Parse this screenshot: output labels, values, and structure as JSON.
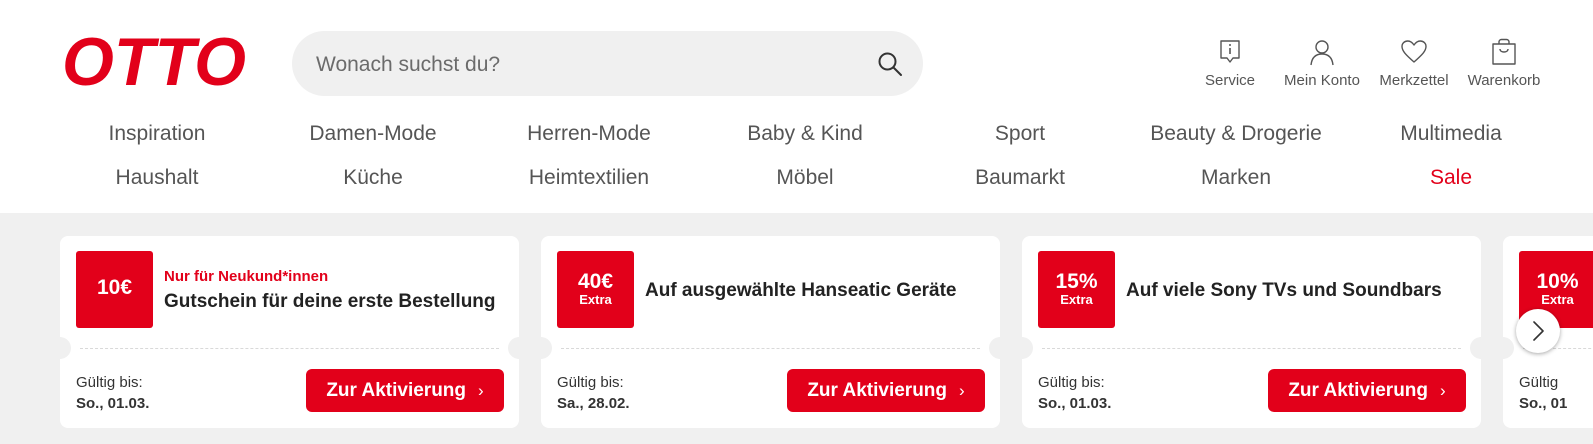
{
  "brand": {
    "logo_text": "OTTO",
    "accent": "#e2001a"
  },
  "search": {
    "placeholder": "Wonach suchst du?",
    "value": "",
    "icon": "search-icon"
  },
  "utility_nav": [
    {
      "label": "Service",
      "icon": "info-icon"
    },
    {
      "label": "Mein Konto",
      "icon": "user-icon"
    },
    {
      "label": "Merkzettel",
      "icon": "heart-icon"
    },
    {
      "label": "Warenkorb",
      "icon": "bag-icon"
    }
  ],
  "categories": {
    "row1": [
      "Inspiration",
      "Damen-Mode",
      "Herren-Mode",
      "Baby & Kind",
      "Sport",
      "Beauty & Drogerie",
      "Multimedia"
    ],
    "row2": [
      "Haushalt",
      "Küche",
      "Heimtextilien",
      "Möbel",
      "Baumarkt",
      "Marken",
      "Sale"
    ]
  },
  "coupons": [
    {
      "badge_value": "10€",
      "badge_sub": "",
      "kicker": "Nur für Neukund*innen",
      "title": "Gutschein für deine erste Bestellung",
      "valid_label": "Gültig bis:",
      "valid_date": "So., 01.03.",
      "cta": "Zur Aktivierung"
    },
    {
      "badge_value": "40€",
      "badge_sub": "Extra",
      "kicker": "",
      "title": "Auf ausgewählte Hanseatic Geräte",
      "valid_label": "Gültig bis:",
      "valid_date": "Sa., 28.02.",
      "cta": "Zur Aktivierung"
    },
    {
      "badge_value": "15%",
      "badge_sub": "Extra",
      "kicker": "",
      "title": "Auf viele Sony TVs und Soundbars",
      "valid_label": "Gültig bis:",
      "valid_date": "So., 01.03.",
      "cta": "Zur Aktivierung"
    },
    {
      "badge_value": "10%",
      "badge_sub": "Extra",
      "kicker": "",
      "title": "",
      "valid_label": "Gültig",
      "valid_date": "So., 01",
      "cta": ""
    }
  ],
  "carousel": {
    "next_icon": "chevron-right-icon"
  }
}
